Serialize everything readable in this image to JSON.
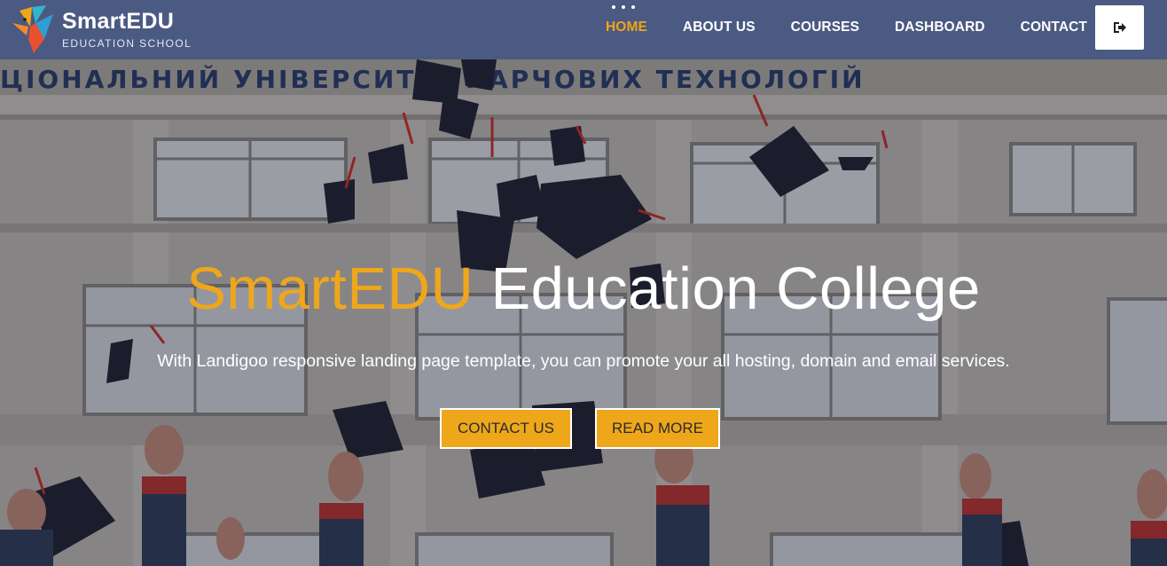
{
  "brand": {
    "title": "SmartEDU",
    "subtitle": "EDUCATION SCHOOL"
  },
  "nav": {
    "items": [
      {
        "label": "HOME",
        "active": true
      },
      {
        "label": "ABOUT US",
        "active": false
      },
      {
        "label": "COURSES",
        "active": false
      },
      {
        "label": "DASHBOARD",
        "active": false
      },
      {
        "label": "CONTACT",
        "active": false
      }
    ],
    "logout_icon": "sign-out-icon"
  },
  "hero": {
    "title_accent": "SmartEDU",
    "title_rest": " Education College",
    "subtitle": "With Landigoo responsive landing page template, you can promote your all hosting, domain and email services.",
    "buttons": {
      "contact_label": "CONTACT US",
      "read_more_label": "READ MORE"
    },
    "background_image": "graduation-caps-thrown-in-front-of-university-building",
    "building_sign": "ЦІОНАЛЬНИЙ УНІВЕРСИТЕТ ХАРЧОВИХ ТЕХНОЛОГІЙ"
  },
  "colors": {
    "navbar_bg": "#4b5a82",
    "accent": "#eea71b",
    "text_light": "#ffffff"
  }
}
